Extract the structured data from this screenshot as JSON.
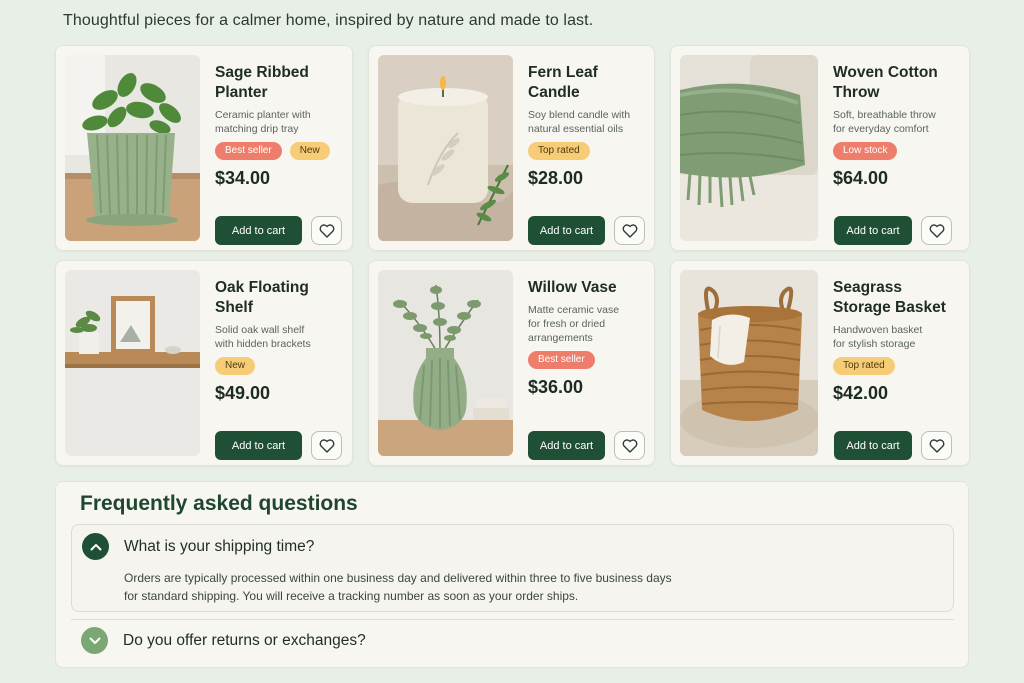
{
  "tagline": "Thoughtful pieces for a calmer home, inspired by nature and made to last.",
  "products": [
    {
      "name": "Sage Ribbed\nPlanter",
      "desc": "Ceramic planter with\nmatching drip tray",
      "badges": [
        {
          "label": "Best seller",
          "tone": "red"
        },
        {
          "label": "New",
          "tone": "yellow"
        }
      ],
      "price": "$34.00",
      "cart": "Add to cart"
    },
    {
      "name": "Fern Leaf\nCandle",
      "desc": "Soy blend candle with\nnatural essential oils",
      "badges": [
        {
          "label": "Top rated",
          "tone": "yellow"
        }
      ],
      "price": "$28.00",
      "cart": "Add to cart"
    },
    {
      "name": "Woven Cotton\nThrow",
      "desc": "Soft, breathable throw\nfor everyday comfort",
      "badges": [
        {
          "label": "Low stock",
          "tone": "red"
        }
      ],
      "price": "$64.00",
      "cart": "Add to cart"
    },
    {
      "name": "Oak Floating\nShelf",
      "desc": "Solid oak wall shelf\nwith hidden brackets",
      "badges": [
        {
          "label": "New",
          "tone": "yellow"
        }
      ],
      "price": "$49.00",
      "cart": "Add to cart"
    },
    {
      "name": "Willow Vase",
      "desc": "Matte ceramic vase\nfor fresh or dried\narrangements",
      "badges": [
        {
          "label": "Best seller",
          "tone": "red"
        }
      ],
      "price": "$36.00",
      "cart": "Add to cart"
    },
    {
      "name": "Seagrass\nStorage Basket",
      "desc": "Handwoven basket\nfor stylish storage",
      "badges": [
        {
          "label": "Top rated",
          "tone": "yellow"
        }
      ],
      "price": "$42.00",
      "cart": "Add to cart"
    }
  ],
  "faq": {
    "title": "Frequently asked questions",
    "items": [
      {
        "question": "What is your shipping time?",
        "answer": "Orders are typically processed within one business day and delivered within three to five business days for standard shipping. You will receive a tracking number as soon as your order ships.",
        "expanded": true,
        "icon": "chevron-up-icon"
      },
      {
        "question": "Do you offer returns or exchanges?",
        "answer": "",
        "expanded": false,
        "icon": "chevron-down-icon"
      }
    ]
  },
  "colors": {
    "accent": "#1f4f35",
    "badge_red": "#ee7e6b",
    "badge_yellow": "#f6cc77",
    "background": "#e8efe6"
  }
}
